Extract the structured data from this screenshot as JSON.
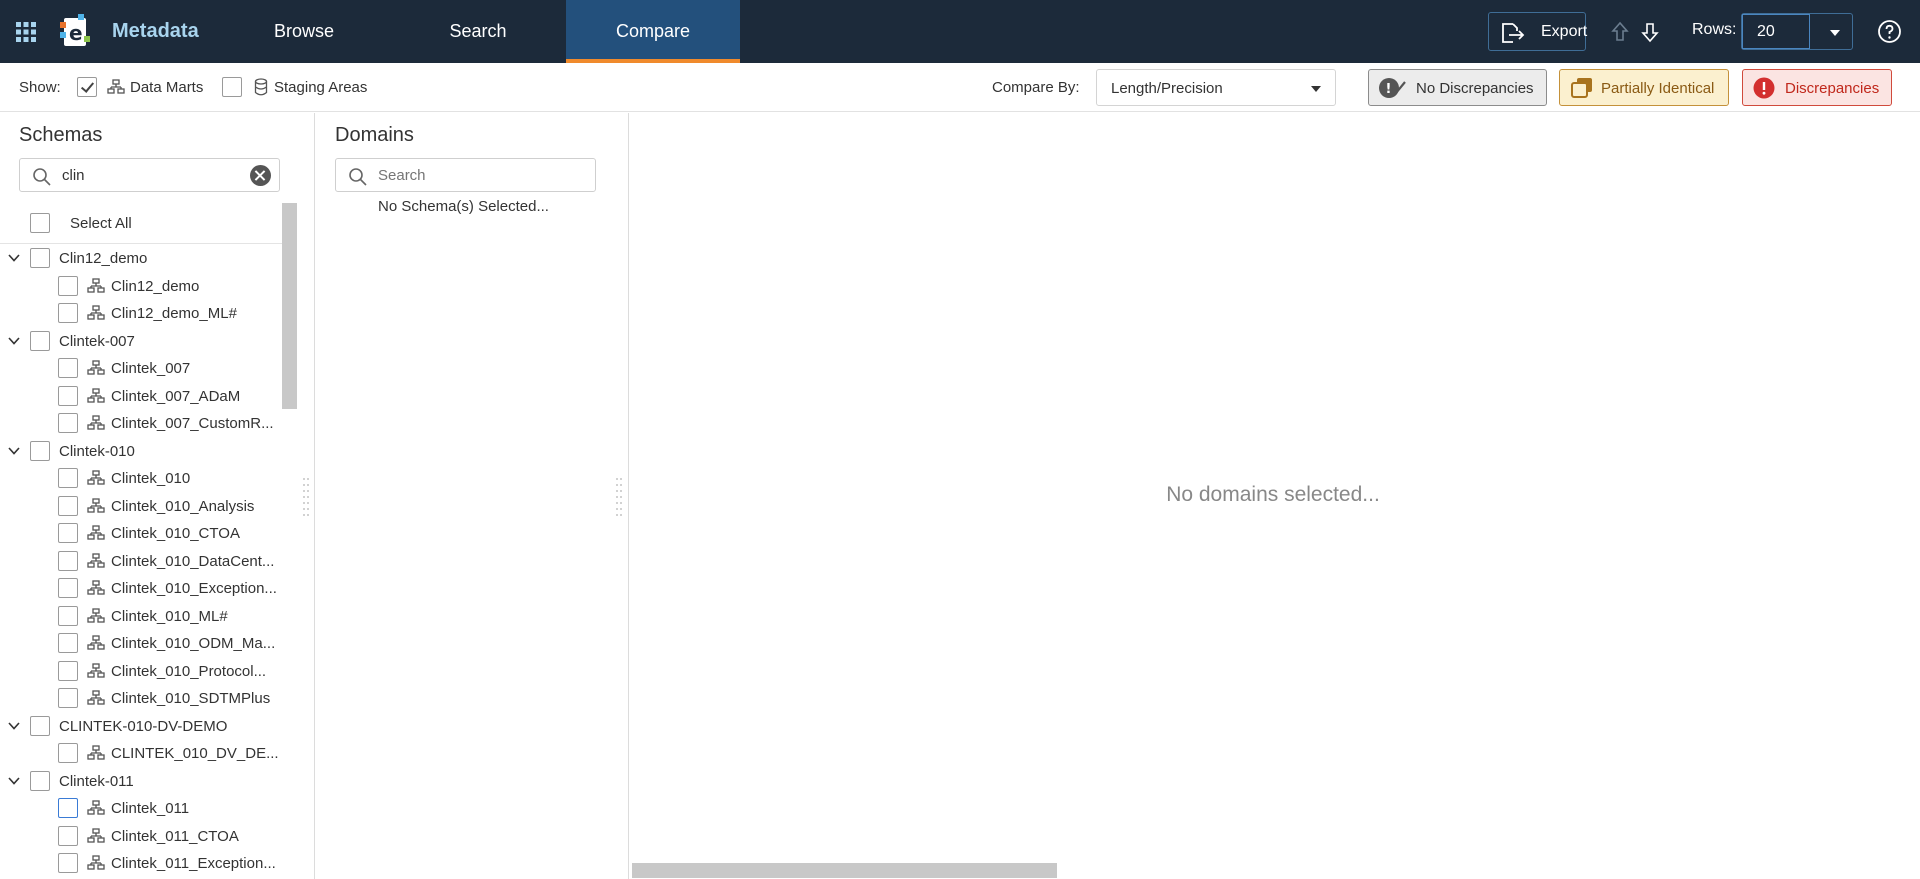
{
  "header": {
    "app_name": "Metadata",
    "tabs": [
      {
        "label": "Browse",
        "active": false
      },
      {
        "label": "Search",
        "active": false
      },
      {
        "label": "Compare",
        "active": true
      }
    ],
    "export_label": "Export",
    "rows_label": "Rows:",
    "rows_value": "20"
  },
  "toolbar": {
    "show_label": "Show:",
    "data_marts_label": "Data Marts",
    "data_marts_checked": true,
    "staging_areas_label": "Staging Areas",
    "staging_areas_checked": false,
    "compare_by_label": "Compare By:",
    "compare_by_value": "Length/Precision",
    "filters": {
      "no_discrepancies": "No Discrepancies",
      "partially_identical": "Partially Identical",
      "discrepancies": "Discrepancies"
    },
    "colors": {
      "partial_accent": "#a8731e",
      "discrepancy_accent": "#d32f2f"
    }
  },
  "schemas": {
    "title": "Schemas",
    "search_value": "clin",
    "select_all_label": "Select All",
    "tree": [
      {
        "type": "group",
        "label": "Clin12_demo"
      },
      {
        "type": "leaf",
        "label": "Clin12_demo"
      },
      {
        "type": "leaf",
        "label": "Clin12_demo_ML#"
      },
      {
        "type": "group",
        "label": "Clintek-007"
      },
      {
        "type": "leaf",
        "label": "Clintek_007"
      },
      {
        "type": "leaf",
        "label": "Clintek_007_ADaM"
      },
      {
        "type": "leaf",
        "label": "Clintek_007_CustomR..."
      },
      {
        "type": "group",
        "label": "Clintek-010"
      },
      {
        "type": "leaf",
        "label": "Clintek_010"
      },
      {
        "type": "leaf",
        "label": "Clintek_010_Analysis"
      },
      {
        "type": "leaf",
        "label": "Clintek_010_CTOA"
      },
      {
        "type": "leaf",
        "label": "Clintek_010_DataCent..."
      },
      {
        "type": "leaf",
        "label": "Clintek_010_Exception..."
      },
      {
        "type": "leaf",
        "label": "Clintek_010_ML#"
      },
      {
        "type": "leaf",
        "label": "Clintek_010_ODM_Ma..."
      },
      {
        "type": "leaf",
        "label": "Clintek_010_Protocol..."
      },
      {
        "type": "leaf",
        "label": "Clintek_010_SDTMPlus"
      },
      {
        "type": "group",
        "label": "CLINTEK-010-DV-DEMO"
      },
      {
        "type": "leaf",
        "label": "CLINTEK_010_DV_DE..."
      },
      {
        "type": "group",
        "label": "Clintek-011"
      },
      {
        "type": "leaf",
        "label": "Clintek_011",
        "focused": true
      },
      {
        "type": "leaf",
        "label": "Clintek_011_CTOA"
      },
      {
        "type": "leaf",
        "label": "Clintek_011_Exception..."
      }
    ]
  },
  "domains": {
    "title": "Domains",
    "search_placeholder": "Search",
    "empty_message": "No Schema(s) Selected..."
  },
  "main": {
    "empty_message": "No domains selected..."
  }
}
